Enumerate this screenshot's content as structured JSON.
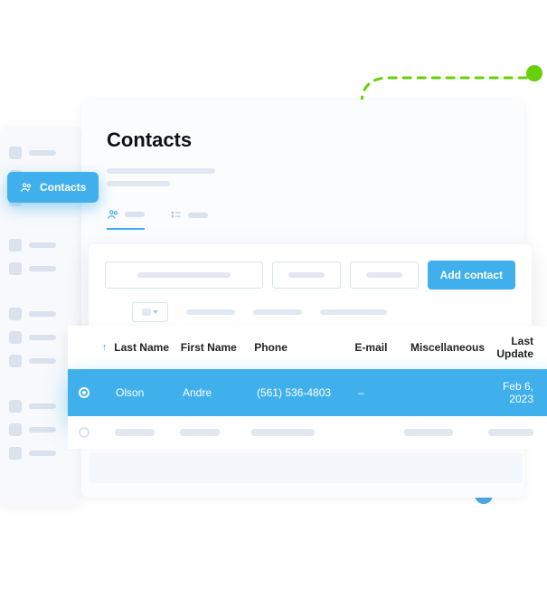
{
  "nav": {
    "active_label": "Contacts"
  },
  "page": {
    "title": "Contacts"
  },
  "actions": {
    "add_contact": "Add contact"
  },
  "table": {
    "sort_indicator": "↑",
    "columns": {
      "last_name": "Last Name",
      "first_name": "First Name",
      "phone": "Phone",
      "email": "E-mail",
      "misc": "Miscellaneous",
      "last_update": "Last Update"
    },
    "rows": [
      {
        "last_name": "Olson",
        "first_name": "Andre",
        "phone": "(561) 536-4803",
        "email": "–",
        "misc": "",
        "last_update": "Feb 6, 2023",
        "selected": true
      }
    ]
  }
}
